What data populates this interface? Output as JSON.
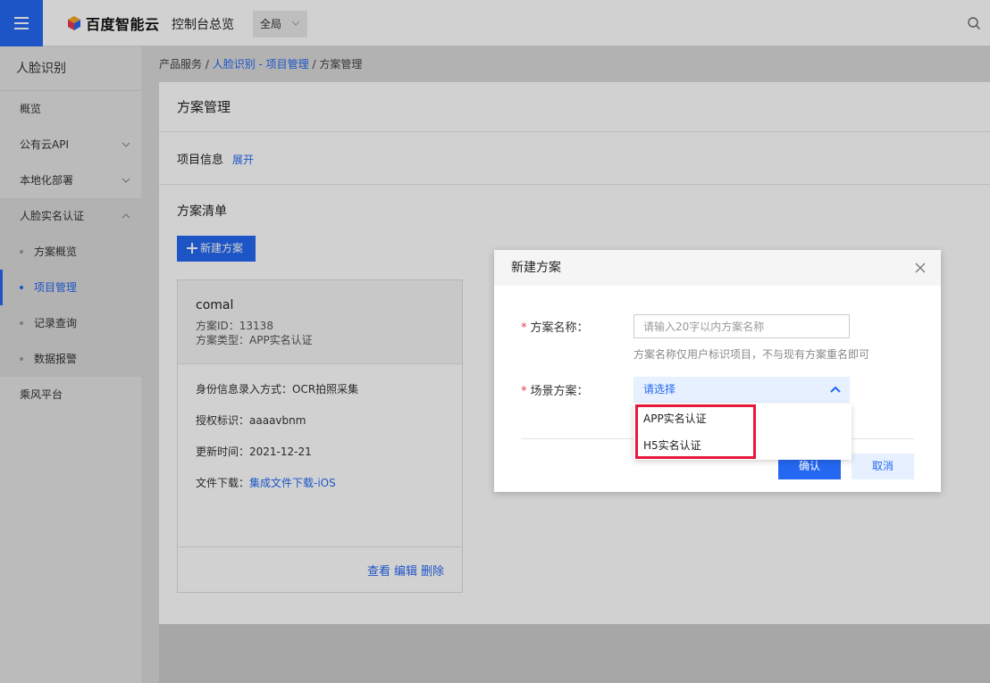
{
  "header": {
    "brand": "百度智能云",
    "console": "控制台总览",
    "region": "全局"
  },
  "sidebar": {
    "title": "人脸识别",
    "items": [
      {
        "label": "概览"
      },
      {
        "label": "公有云API"
      },
      {
        "label": "本地化部署"
      },
      {
        "label": "人脸实名认证"
      }
    ],
    "subitems": [
      {
        "label": "方案概览"
      },
      {
        "label": "项目管理"
      },
      {
        "label": "记录查询"
      },
      {
        "label": "数据报警"
      }
    ],
    "last": "乘风平台"
  },
  "breadcrumb": {
    "root": "产品服务",
    "sep1": " / ",
    "link": "人脸识别 - 项目管理",
    "sep2": " / ",
    "current": "方案管理"
  },
  "main": {
    "title": "方案管理",
    "project_info": "项目信息",
    "expand": "展开",
    "list_title": "方案清单",
    "new_button": "新建方案"
  },
  "card": {
    "name": "comal",
    "id_line": "方案ID：13138",
    "type_line": "方案类型：APP实名认证",
    "input_label": "身份信息录入方式：",
    "input_value": "OCR拍照采集",
    "auth_label": "授权标识：",
    "auth_value": "aaaavbnm",
    "update_label": "更新时间：",
    "update_value": "2021-12-21",
    "download_label": "文件下载：",
    "download_link": "集成文件下载-iOS",
    "actions": {
      "view": "查看",
      "edit": "编辑",
      "delete": "删除"
    }
  },
  "modal": {
    "title": "新建方案",
    "name_label": "方案名称：",
    "name_placeholder": "请输入20字以内方案名称",
    "name_hint": "方案名称仅用户标识项目，不与现有方案重名即可",
    "scene_label": "场景方案：",
    "scene_value": "请选择",
    "ok": "确认",
    "cancel": "取消",
    "required_mark": "*"
  },
  "dropdown": {
    "options": [
      "APP实名认证",
      "H5实名认证"
    ]
  },
  "colors": {
    "accent": "#2468f2",
    "highlight": "#e8193c"
  }
}
